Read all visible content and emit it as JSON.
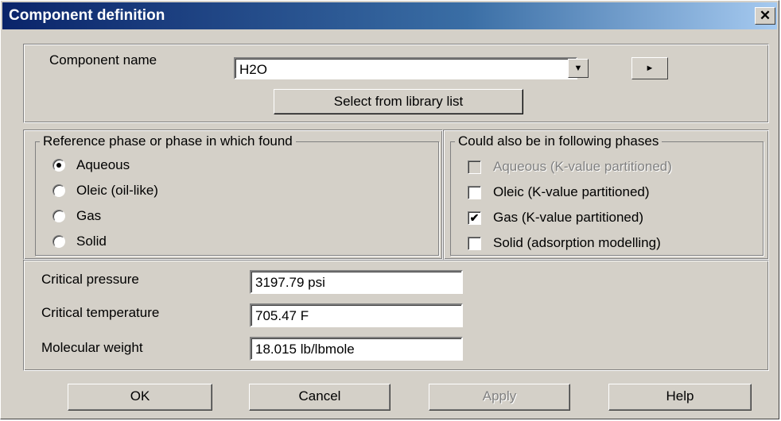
{
  "window": {
    "title": "Component definition",
    "close_glyph": "✕"
  },
  "component": {
    "name_label": "Component name",
    "name_value": "H2O",
    "dropdown_icon": "▼",
    "next_icon": "►",
    "library_button": "Select from library list"
  },
  "reference_phase": {
    "legend": "Reference phase or phase in which found",
    "options": [
      "Aqueous",
      "Oleic (oil-like)",
      "Gas",
      "Solid"
    ],
    "selected": "Aqueous"
  },
  "other_phases": {
    "legend": "Could also be in following phases",
    "options": [
      {
        "label": "Aqueous (K-value partitioned)",
        "checked": false,
        "disabled": true
      },
      {
        "label": "Oleic (K-value partitioned)",
        "checked": false,
        "disabled": false
      },
      {
        "label": "Gas (K-value partitioned)",
        "checked": true,
        "disabled": false
      },
      {
        "label": "Solid (adsorption modelling)",
        "checked": false,
        "disabled": false
      }
    ],
    "check_glyph": "✔"
  },
  "properties": {
    "critical_pressure_label": "Critical pressure",
    "critical_pressure_value": "3197.79 psi",
    "critical_temperature_label": "Critical temperature",
    "critical_temperature_value": "705.47 F",
    "molecular_weight_label": "Molecular weight",
    "molecular_weight_value": "18.015 lb/lbmole"
  },
  "buttons": {
    "ok": "OK",
    "cancel": "Cancel",
    "apply": "Apply",
    "help": "Help"
  }
}
